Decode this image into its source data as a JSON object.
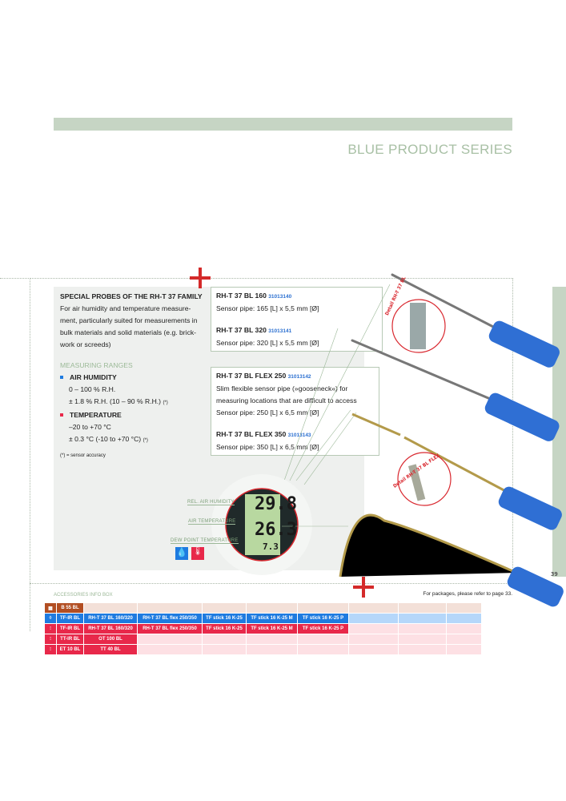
{
  "header": {
    "series_title": "BLUE PRODUCT SERIES"
  },
  "intro": {
    "title": "SPECIAL PROBES OF THE RH-T 37 FAMILY",
    "lines": [
      "For air humidity and temperature measure-",
      "ment, particularly suited for measurements in",
      "bulk materials and solid materials (e.g. brick-",
      "work or screeds)"
    ]
  },
  "ranges": {
    "heading": "MEASURING RANGES",
    "humidity": {
      "label": "AIR HUMIDITY",
      "range": "0 – 100 % R.H.",
      "accuracy": "± 1.8 % R.H. (10 – 90 % R.H.)",
      "note": "(*)",
      "color": "#1e7be0"
    },
    "temperature": {
      "label": "TEMPERATURE",
      "range": "–20 to +70 °C",
      "accuracy": "± 0.3 °C  (-10 to +70 °C)",
      "note": "(*)",
      "color": "#e8284a"
    },
    "footnote": "(*) = sensor accuracy"
  },
  "products": [
    {
      "name": "RH-T 37 BL 160",
      "code": "31013140",
      "desc": [
        "Sensor pipe: 165 [L] x 5,5 mm [Ø]"
      ]
    },
    {
      "name": "RH-T 37 BL 320",
      "code": "31013141",
      "desc": [
        "Sensor pipe: 320 [L] x 5,5 mm [Ø]"
      ]
    },
    {
      "name": "RH-T 37 BL FLEX 250",
      "code": "31013142",
      "desc": [
        "Slim flexible sensor pipe (»gooseneck«) for",
        "measuring locations that are difficult to access",
        "Sensor pipe: 250 [L] x 6,5 mm [Ø]"
      ]
    },
    {
      "name": "RH-T 37 BL FLEX 350",
      "code": "31013143",
      "desc": [
        "Sensor pipe: 350 [L] x 6,5 mm [Ø]"
      ]
    }
  ],
  "display": {
    "labels": [
      "REL. AIR HUMIDITY",
      "AIR TEMPERATURE",
      "DEW POINT TEMPERATURE"
    ],
    "values": [
      "29.8",
      "26.3",
      "7.3"
    ]
  },
  "details": [
    "Detail RH-T 37 BL",
    "Detail RH-T 37 BL FLEX"
  ],
  "accessories": {
    "title": "ACCESSORIES INFO BOX",
    "note": "For packages, please refer to page 33.",
    "rows": [
      {
        "icon": "brick-wall-icon",
        "cells": [
          "B 55 BL"
        ]
      },
      {
        "icon": "water-drop-icon",
        "cells": [
          "TF-IR BL",
          "RH-T 37 BL 160/320",
          "RH-T 37 BL flex 250/350",
          "TF stick 16 K-25",
          "TF stick 16 K-25 M",
          "TF stick 16 K-25 P"
        ]
      },
      {
        "icon": "thermometer-material-icon",
        "cells": [
          "TF-IR BL",
          "RH-T 37 BL 160/320",
          "RH-T 37 BL flex 250/350",
          "TF stick 16 K-25",
          "TF stick 16 K-25 M",
          "TF stick 16 K-25 P"
        ]
      },
      {
        "icon": "thermometer-drop-icon",
        "cells": [
          "TT-IR BL",
          "OT 100 BL"
        ]
      },
      {
        "icon": "thermometer-ground-icon",
        "cells": [
          "ET 10 BL",
          "TT 40 BL"
        ]
      }
    ]
  },
  "page_number": "39"
}
